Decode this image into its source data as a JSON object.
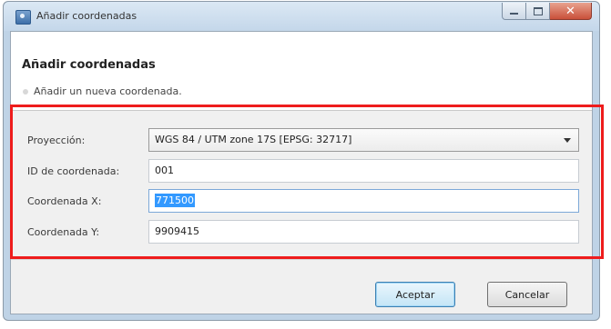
{
  "window": {
    "title": "Añadir coordenadas",
    "close_glyph": "✕"
  },
  "header": {
    "title": "Añadir coordenadas",
    "subtitle": "Añadir un nueva coordenada."
  },
  "form": {
    "projection_label": "Proyección:",
    "projection_value": "WGS 84 / UTM zone 17S [EPSG: 32717]",
    "id_label": "ID de coordenada:",
    "id_value": "001",
    "x_label": "Coordenada X:",
    "x_value": "771500",
    "y_label": "Coordenada Y:",
    "y_value": "9909415"
  },
  "buttons": {
    "accept_label": "Aceptar",
    "cancel_label": "Cancelar"
  },
  "colors": {
    "highlight_box": "#ee1c1c",
    "selection": "#3399ff"
  }
}
